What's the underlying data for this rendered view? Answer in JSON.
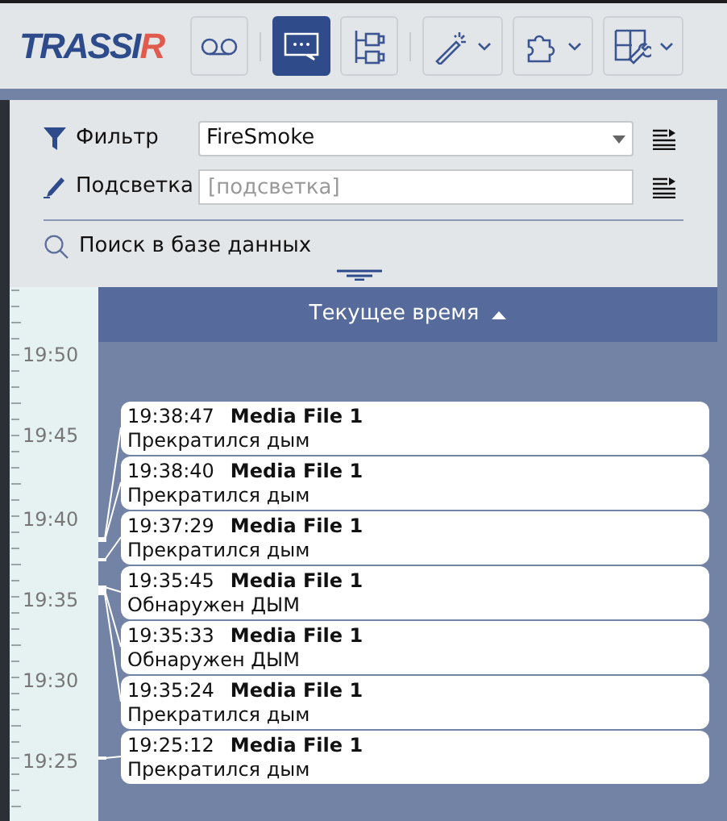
{
  "logo": {
    "text": "TRASSI",
    "accent": "R"
  },
  "toolbar": [
    {
      "kind": "tape",
      "selected": false,
      "menu": false
    },
    {
      "kind": "chat",
      "selected": true,
      "menu": false
    },
    {
      "kind": "tree",
      "selected": false,
      "menu": false
    },
    {
      "kind": "wand",
      "selected": false,
      "menu": true
    },
    {
      "kind": "puzzle",
      "selected": false,
      "menu": true
    },
    {
      "kind": "grid",
      "selected": false,
      "menu": true
    }
  ],
  "filter": {
    "label": "Фильтр",
    "value": "FireSmoke"
  },
  "highlight": {
    "label": "Подсветка",
    "placeholder": "[подсветка]"
  },
  "search_link": "Поиск в базе данных",
  "timeline": {
    "header": "Текущее время",
    "ruler_labels": [
      "19:50",
      "19:45",
      "19:40",
      "19:35",
      "19:30",
      "19:25"
    ],
    "events": [
      {
        "time": "19:38:47",
        "source": "Media File 1",
        "message": "Прекратился дым"
      },
      {
        "time": "19:38:40",
        "source": "Media File 1",
        "message": "Прекратился дым"
      },
      {
        "time": "19:37:29",
        "source": "Media File 1",
        "message": "Прекратился дым"
      },
      {
        "time": "19:35:45",
        "source": "Media File 1",
        "message": "Обнаружен ДЫМ"
      },
      {
        "time": "19:35:33",
        "source": "Media File 1",
        "message": "Обнаружен ДЫМ"
      },
      {
        "time": "19:35:24",
        "source": "Media File 1",
        "message": "Прекратился дым"
      },
      {
        "time": "19:25:12",
        "source": "Media File 1",
        "message": "Прекратился дым"
      }
    ]
  }
}
